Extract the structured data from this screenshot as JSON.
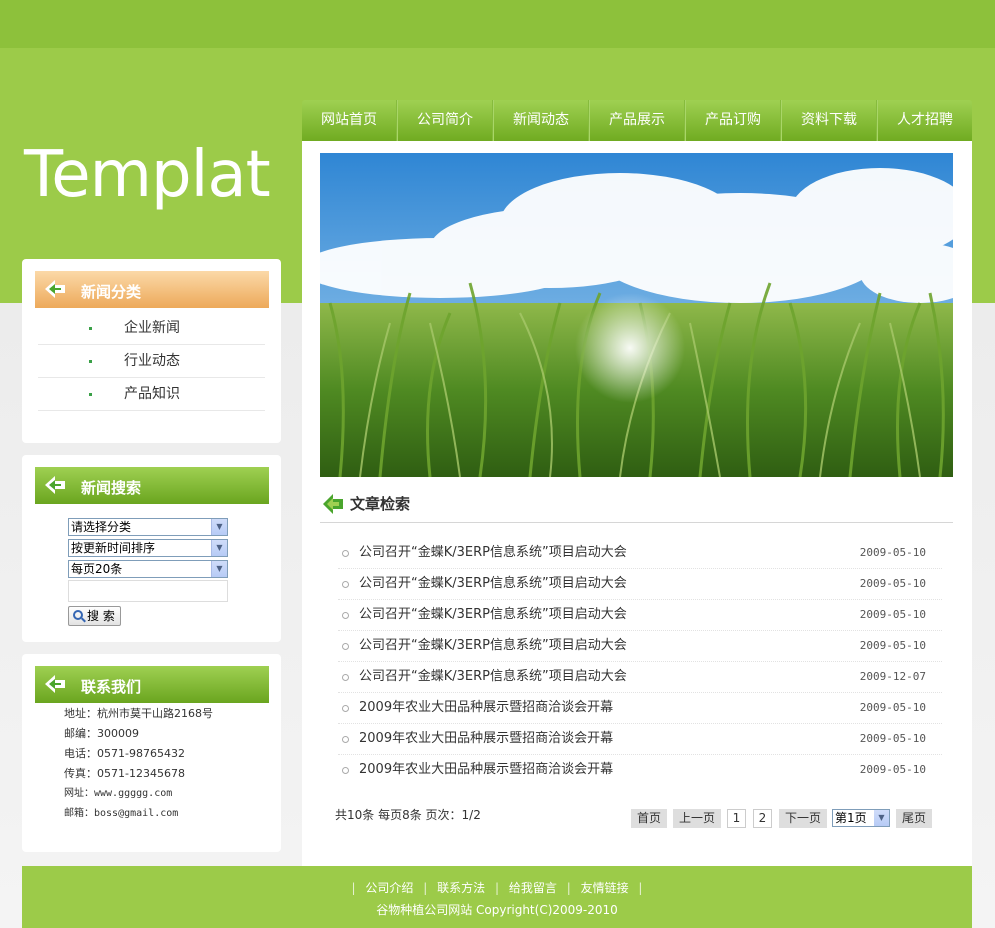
{
  "logo": {
    "text": "Template"
  },
  "nav": {
    "items": [
      "网站首页",
      "公司简介",
      "新闻动态",
      "产品展示",
      "产品订购",
      "资料下载",
      "人才招聘"
    ]
  },
  "sidebar": {
    "categories": {
      "title": "新闻分类",
      "items": [
        "企业新闻",
        "行业动态",
        "产品知识"
      ]
    },
    "search": {
      "title": "新闻搜索",
      "category_select": "请选择分类",
      "sort_select": "按更新时间排序",
      "per_page_select": "每页20条",
      "button_label": "搜 索"
    },
    "contact": {
      "title": "联系我们",
      "address": "地址：杭州市莫干山路2168号",
      "postcode": "邮编：300009",
      "phone": "电话：0571-98765432",
      "fax": "传真：0571-12345678",
      "website": "网址：www.ggggg.com",
      "email": "邮箱：boss@gmail.com"
    }
  },
  "articles": {
    "title": "文章检索",
    "items": [
      {
        "title": "公司召开“金蝶K/3ERP信息系统”项目启动大会",
        "date": "2009-05-10"
      },
      {
        "title": "公司召开“金蝶K/3ERP信息系统”项目启动大会",
        "date": "2009-05-10"
      },
      {
        "title": "公司召开“金蝶K/3ERP信息系统”项目启动大会",
        "date": "2009-05-10"
      },
      {
        "title": "公司召开“金蝶K/3ERP信息系统”项目启动大会",
        "date": "2009-05-10"
      },
      {
        "title": "公司召开“金蝶K/3ERP信息系统”项目启动大会",
        "date": "2009-12-07"
      },
      {
        "title": "2009年农业大田品种展示暨招商洽谈会开幕",
        "date": "2009-05-10"
      },
      {
        "title": "2009年农业大田品种展示暨招商洽谈会开幕",
        "date": "2009-05-10"
      },
      {
        "title": "2009年农业大田品种展示暨招商洽谈会开幕",
        "date": "2009-05-10"
      }
    ]
  },
  "pager": {
    "info": "共10条 每页8条 页次：1/2",
    "first": "首页",
    "prev": "上一页",
    "page1": "1",
    "page2": "2",
    "next": "下一页",
    "select": "第1页",
    "last": "尾页"
  },
  "footer": {
    "links": [
      "公司介绍",
      "联系方法",
      "给我留言",
      "友情链接"
    ],
    "separator": "|",
    "copyright": "谷物种植公司网站 Copyright(C)2009-2010"
  },
  "colors": {
    "brand_green": "#9ccb49",
    "dark_green": "#8dc13b",
    "orange_head": "#eda95a"
  }
}
